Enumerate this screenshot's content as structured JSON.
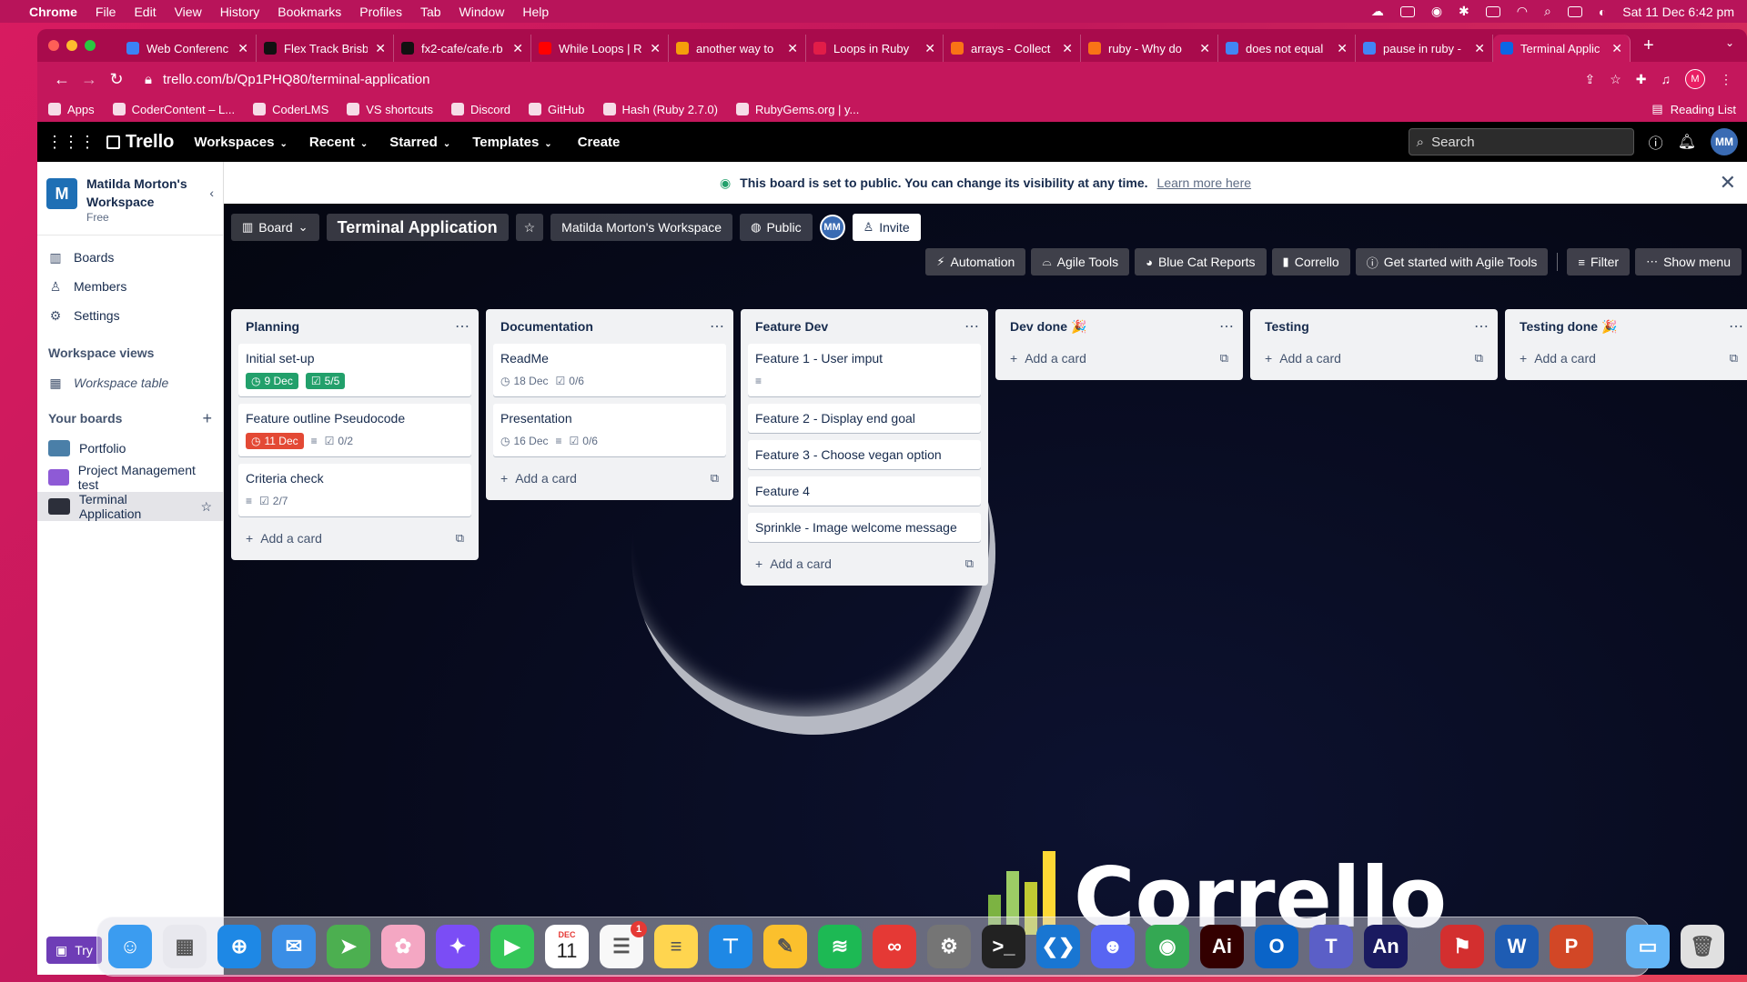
{
  "menubar": {
    "app": "Chrome",
    "items": [
      "File",
      "Edit",
      "View",
      "History",
      "Bookmarks",
      "Profiles",
      "Tab",
      "Window",
      "Help"
    ],
    "clock": "Sat 11 Dec  6:42 pm"
  },
  "tabs": [
    {
      "title": "Web Conferenc",
      "color": "#3b82f6"
    },
    {
      "title": "Flex Track Brisb",
      "color": "#111111"
    },
    {
      "title": "fx2-cafe/cafe.rb",
      "color": "#111111"
    },
    {
      "title": "While Loops | R",
      "color": "#ff0000"
    },
    {
      "title": "another way to",
      "color": "#f59e0b"
    },
    {
      "title": "Loops in Ruby",
      "color": "#e11d48"
    },
    {
      "title": "arrays - Collect",
      "color": "#f97316"
    },
    {
      "title": "ruby - Why do",
      "color": "#f97316"
    },
    {
      "title": "does not equal",
      "color": "#4285f4"
    },
    {
      "title": "pause in ruby -",
      "color": "#4285f4"
    },
    {
      "title": "Terminal Applic",
      "color": "#0c66e4",
      "active": true
    }
  ],
  "url": "trello.com/b/Qp1PHQ80/terminal-application",
  "profile_initial": "M",
  "bookmarks": [
    "Apps",
    "CoderContent – L...",
    "CoderLMS",
    "VS shortcuts",
    "Discord",
    "GitHub",
    "Hash (Ruby 2.7.0)",
    "RubyGems.org | y..."
  ],
  "reading_list": "Reading List",
  "trello": {
    "logo": "Trello",
    "nav": [
      "Workspaces",
      "Recent",
      "Starred",
      "Templates"
    ],
    "create": "Create",
    "search_placeholder": "Search",
    "user_initials": "MM"
  },
  "sidebar": {
    "workspace_initial": "M",
    "workspace_name": "Matilda Morton's Workspace",
    "plan": "Free",
    "items": [
      {
        "label": "Boards",
        "icon": "board-icon"
      },
      {
        "label": "Members",
        "icon": "person-icon"
      },
      {
        "label": "Settings",
        "icon": "gear-icon"
      }
    ],
    "views_heading": "Workspace views",
    "workspace_table": "Workspace table",
    "boards_heading": "Your boards",
    "boards": [
      {
        "label": "Portfolio",
        "color": "#4a7fa8"
      },
      {
        "label": "Project Management test",
        "color": "#8e5ad6"
      },
      {
        "label": "Terminal Application",
        "color": "#2c2f3a",
        "active": true
      }
    ],
    "try_premium": "Try"
  },
  "banner": {
    "message": "This board is set to public. You can change its visibility at any time.",
    "link": "Learn more here"
  },
  "board": {
    "view": "Board",
    "title": "Terminal Application",
    "workspace": "Matilda Morton's Workspace",
    "visibility": "Public",
    "member_initials": "MM",
    "invite": "Invite",
    "power_ups": [
      "Automation",
      "Agile Tools",
      "Blue Cat Reports",
      "Corrello",
      "Get started with Agile Tools"
    ],
    "filter": "Filter",
    "show_menu": "Show menu"
  },
  "lists": [
    {
      "name": "Planning",
      "cards": [
        {
          "title": "Initial set-up",
          "due": "9 Dec",
          "due_status": "green",
          "checklist": "5/5",
          "checklist_status": "green"
        },
        {
          "title": "Feature outline Pseudocode",
          "due": "11 Dec",
          "due_status": "red",
          "description": true,
          "checklist": "0/2"
        },
        {
          "title": "Criteria check",
          "description": true,
          "checklist": "2/7"
        }
      ],
      "add": "Add a card"
    },
    {
      "name": "Documentation",
      "cards": [
        {
          "title": "ReadMe",
          "due": "18 Dec",
          "checklist": "0/6"
        },
        {
          "title": "Presentation",
          "due": "16 Dec",
          "description": true,
          "checklist": "0/6"
        }
      ],
      "add": "Add a card"
    },
    {
      "name": "Feature Dev",
      "cards": [
        {
          "title": "Feature 1 - User imput",
          "description": true
        },
        {
          "title": "Feature 2 - Display end goal"
        },
        {
          "title": "Feature 3 - Choose vegan option"
        },
        {
          "title": "Feature 4"
        },
        {
          "title": "Sprinkle - Image welcome message"
        }
      ],
      "add": "Add a card"
    },
    {
      "name": "Dev done",
      "emoji": "🎉",
      "cards": [],
      "add": "Add a card"
    },
    {
      "name": "Testing",
      "cards": [],
      "add": "Add a card"
    },
    {
      "name": "Testing done",
      "emoji": "🎉",
      "cards": [],
      "add": "Add a card"
    }
  ],
  "background_wordmark": "Corrello",
  "dock": {
    "calendar_month": "DEC",
    "calendar_day": "11",
    "reminders_badge": "1",
    "apps": [
      {
        "name": "finder",
        "color": "#3b9cf0",
        "glyph": "☺"
      },
      {
        "name": "launchpad",
        "color": "#e8e8ee",
        "glyph": "▦"
      },
      {
        "name": "safari",
        "color": "#1e88e5",
        "glyph": "⊕"
      },
      {
        "name": "mail",
        "color": "#3a8ee6",
        "glyph": "✉"
      },
      {
        "name": "maps",
        "color": "#4caf50",
        "glyph": "➤"
      },
      {
        "name": "photos",
        "color": "#f4a7c3",
        "glyph": "✿"
      },
      {
        "name": "messenger",
        "color": "#7b4df5",
        "glyph": "✦"
      },
      {
        "name": "facetime",
        "color": "#34c759",
        "glyph": "▶"
      },
      {
        "name": "calendar",
        "color": "#ffffff",
        "glyph": ""
      },
      {
        "name": "reminders",
        "color": "#f8f8f8",
        "glyph": "☰"
      },
      {
        "name": "notes",
        "color": "#ffd54f",
        "glyph": "≡"
      },
      {
        "name": "keynote",
        "color": "#1e88e5",
        "glyph": "⊤"
      },
      {
        "name": "pages",
        "color": "#fbc02d",
        "glyph": "✎"
      },
      {
        "name": "spotify",
        "color": "#1db954",
        "glyph": "≋"
      },
      {
        "name": "creative-cloud",
        "color": "#e53935",
        "glyph": "∞"
      },
      {
        "name": "system-preferences",
        "color": "#757575",
        "glyph": "⚙"
      },
      {
        "name": "terminal",
        "color": "#222222",
        "glyph": ">_"
      },
      {
        "name": "vscode",
        "color": "#1976d2",
        "glyph": "❮❯"
      },
      {
        "name": "discord",
        "color": "#5865f2",
        "glyph": "☻"
      },
      {
        "name": "chrome",
        "color": "#34a853",
        "glyph": "◉"
      },
      {
        "name": "illustrator",
        "color": "#330000",
        "glyph": "Ai"
      },
      {
        "name": "outlook",
        "color": "#0a64c8",
        "glyph": "O"
      },
      {
        "name": "teams",
        "color": "#5b5fc7",
        "glyph": "T"
      },
      {
        "name": "animate",
        "color": "#1a1a60",
        "glyph": "An"
      }
    ],
    "apps2": [
      {
        "name": "acrobat",
        "color": "#d32f2f",
        "glyph": "⚑"
      },
      {
        "name": "word",
        "color": "#1e5cb3",
        "glyph": "W"
      },
      {
        "name": "powerpoint",
        "color": "#d24726",
        "glyph": "P"
      }
    ],
    "apps3": [
      {
        "name": "downloads-folder",
        "color": "#64b5f6",
        "glyph": "▭"
      },
      {
        "name": "trash",
        "color": "#e0e0e0",
        "glyph": "🗑"
      }
    ]
  }
}
